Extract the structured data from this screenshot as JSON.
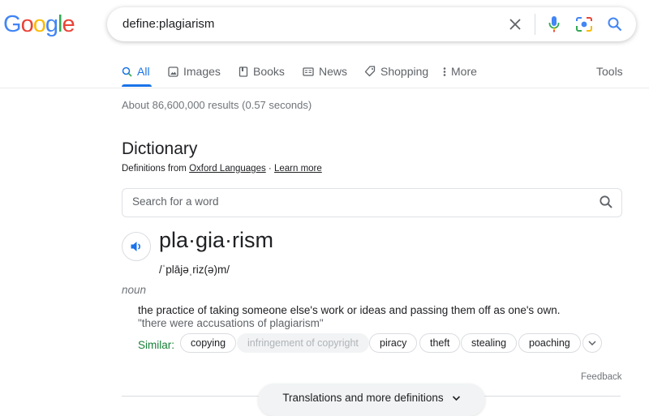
{
  "logo": {
    "letters": [
      "G",
      "o",
      "o",
      "g",
      "l",
      "e"
    ],
    "colors": [
      "#4285F4",
      "#EA4335",
      "#FBBC05",
      "#4285F4",
      "#34A853",
      "#EA4335"
    ]
  },
  "search": {
    "query": "define:plagiarism"
  },
  "tabs": [
    {
      "label": "All",
      "icon": "search-icon",
      "active": true
    },
    {
      "label": "Images",
      "icon": "image-icon"
    },
    {
      "label": "Books",
      "icon": "book-icon"
    },
    {
      "label": "News",
      "icon": "news-icon"
    },
    {
      "label": "Shopping",
      "icon": "tag-icon"
    },
    {
      "label": "More",
      "icon": "more-vert-icon"
    }
  ],
  "tools_label": "Tools",
  "result_stats": "About 86,600,000 results (0.57 seconds)",
  "dictionary": {
    "title": "Dictionary",
    "defs_prefix": "Definitions from",
    "source_link": "Oxford Languages",
    "separator": "·",
    "learn_more": "Learn more",
    "search_placeholder": "Search for a word",
    "headword": "pla·gia·rism",
    "phonetic": "/ˈplājəˌriz(ə)m/",
    "part_of_speech": "noun",
    "definition": "the practice of taking someone else's work or ideas and passing them off as one's own.",
    "example": "\"there were accusations of plagiarism\"",
    "similar_label": "Similar:",
    "similar": [
      "copying",
      "infringement of copyright",
      "piracy",
      "theft",
      "stealing",
      "poaching"
    ],
    "feedback": "Feedback",
    "translations_label": "Translations and more definitions"
  },
  "colors": {
    "accent": "#1a73e8",
    "similar_green": "#188038"
  }
}
